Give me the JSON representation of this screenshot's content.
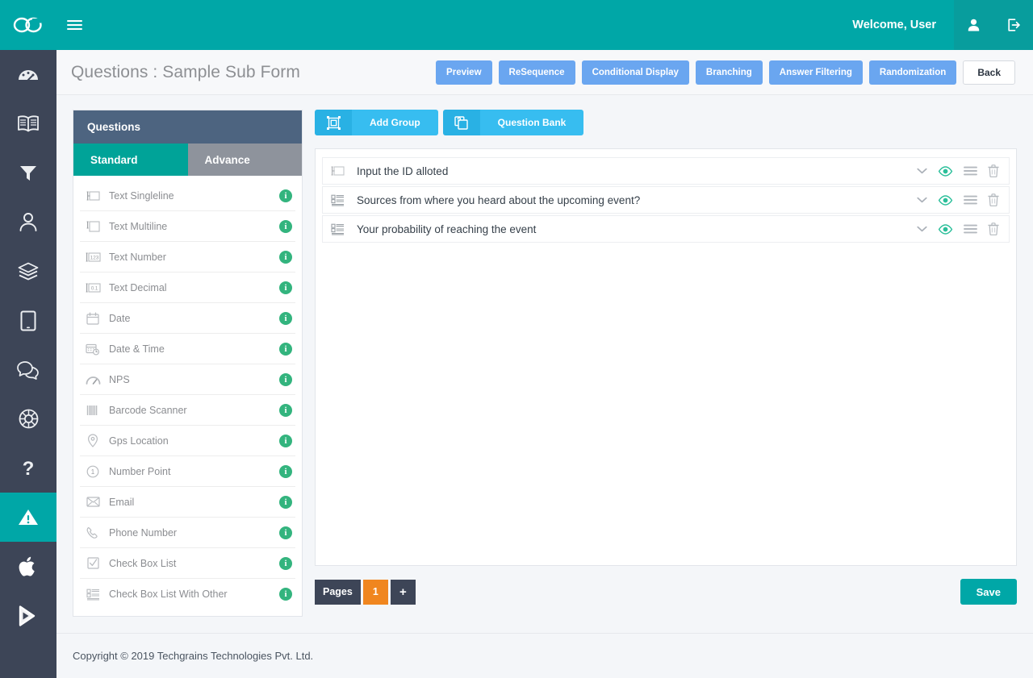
{
  "topbar": {
    "brand_icon": "infinity-logo-icon",
    "menu_icon": "hamburger-menu-icon",
    "welcome_text": "Welcome, User",
    "user_icon": "user-account-icon",
    "logout_icon": "logout-icon",
    "bg_color": "#00a7a7",
    "icon_bg_color": "#089d9d"
  },
  "rail": {
    "bg_color": "#3d4557",
    "active_color": "#00a7a7",
    "items": [
      {
        "name": "dashboard",
        "icon": "gauge-icon",
        "active": false
      },
      {
        "name": "library",
        "icon": "book-icon",
        "active": false
      },
      {
        "name": "filters",
        "icon": "funnel-icon",
        "active": false
      },
      {
        "name": "users",
        "icon": "user-icon",
        "active": false
      },
      {
        "name": "layers",
        "icon": "layers-icon",
        "active": false
      },
      {
        "name": "devices",
        "icon": "tablet-icon",
        "active": false
      },
      {
        "name": "messages",
        "icon": "chat-bubbles-icon",
        "active": false
      },
      {
        "name": "support",
        "icon": "lifebuoy-icon",
        "active": false
      },
      {
        "name": "help",
        "icon": "question-mark-icon",
        "active": false
      },
      {
        "name": "alerts",
        "icon": "warning-triangle-icon",
        "active": true
      },
      {
        "name": "ios-app",
        "icon": "apple-icon",
        "active": false
      },
      {
        "name": "android-app",
        "icon": "play-store-icon",
        "active": false
      }
    ]
  },
  "header": {
    "title": "Questions : Sample Sub Form",
    "buttons": [
      {
        "label": "Preview",
        "style": "blue"
      },
      {
        "label": "ReSequence",
        "style": "blue"
      },
      {
        "label": "Conditional Display",
        "style": "blue"
      },
      {
        "label": "Branching",
        "style": "blue"
      },
      {
        "label": "Answer Filtering",
        "style": "blue"
      },
      {
        "label": "Randomization",
        "style": "blue"
      }
    ],
    "back_label": "Back",
    "blue_color": "#6aa6f0"
  },
  "questions_panel": {
    "title": "Questions",
    "header_color": "#4d6480",
    "tabs": [
      {
        "label": "Standard",
        "active": true
      },
      {
        "label": "Advance",
        "active": false
      }
    ],
    "info_badge": "i",
    "types": [
      {
        "label": "Text Singleline",
        "icon": "text-singleline-icon"
      },
      {
        "label": "Text Multiline",
        "icon": "text-multiline-icon"
      },
      {
        "label": "Text Number",
        "icon": "text-number-icon"
      },
      {
        "label": "Text Decimal",
        "icon": "text-decimal-icon"
      },
      {
        "label": "Date",
        "icon": "calendar-icon"
      },
      {
        "label": "Date & Time",
        "icon": "calendar-clock-icon"
      },
      {
        "label": "NPS",
        "icon": "gauge-nps-icon"
      },
      {
        "label": "Barcode Scanner",
        "icon": "barcode-icon"
      },
      {
        "label": "Gps Location",
        "icon": "map-pin-icon"
      },
      {
        "label": "Number Point",
        "icon": "number-circle-icon"
      },
      {
        "label": "Email",
        "icon": "envelope-icon"
      },
      {
        "label": "Phone Number",
        "icon": "phone-icon"
      },
      {
        "label": "Check Box List",
        "icon": "checkbox-icon"
      },
      {
        "label": "Check Box List With Other",
        "icon": "checkbox-list-other-icon"
      }
    ]
  },
  "builder": {
    "toolbar": [
      {
        "label": "Add Group",
        "icon": "add-group-icon"
      },
      {
        "label": "Question Bank",
        "icon": "question-bank-icon"
      }
    ],
    "toolbar_color": "#37bdf0",
    "items": [
      {
        "text": "Input the ID alloted",
        "icon": "text-singleline-icon"
      },
      {
        "text": "Sources from where you heard about the upcoming event?",
        "icon": "checkbox-list-other-icon"
      },
      {
        "text": "Your probability of reaching the event",
        "icon": "checkbox-list-other-icon"
      }
    ],
    "row_actions": [
      {
        "name": "expand",
        "icon": "chevron-down-icon",
        "color": "#aab0b8"
      },
      {
        "name": "preview",
        "icon": "eye-icon",
        "color": "#2bbf9a"
      },
      {
        "name": "reorder",
        "icon": "list-handle-icon",
        "color": "#b4b9bf"
      },
      {
        "name": "delete",
        "icon": "trash-icon",
        "color": "#b4b9bf"
      }
    ],
    "pages": {
      "label": "Pages",
      "current": "1",
      "add_label": "+",
      "label_color": "#3d4557",
      "current_color": "#f0861f"
    },
    "save_label": "Save",
    "save_color": "#00a7a7"
  },
  "footer": {
    "copyright": "Copyright © 2019 Techgrains Technologies Pvt. Ltd."
  }
}
